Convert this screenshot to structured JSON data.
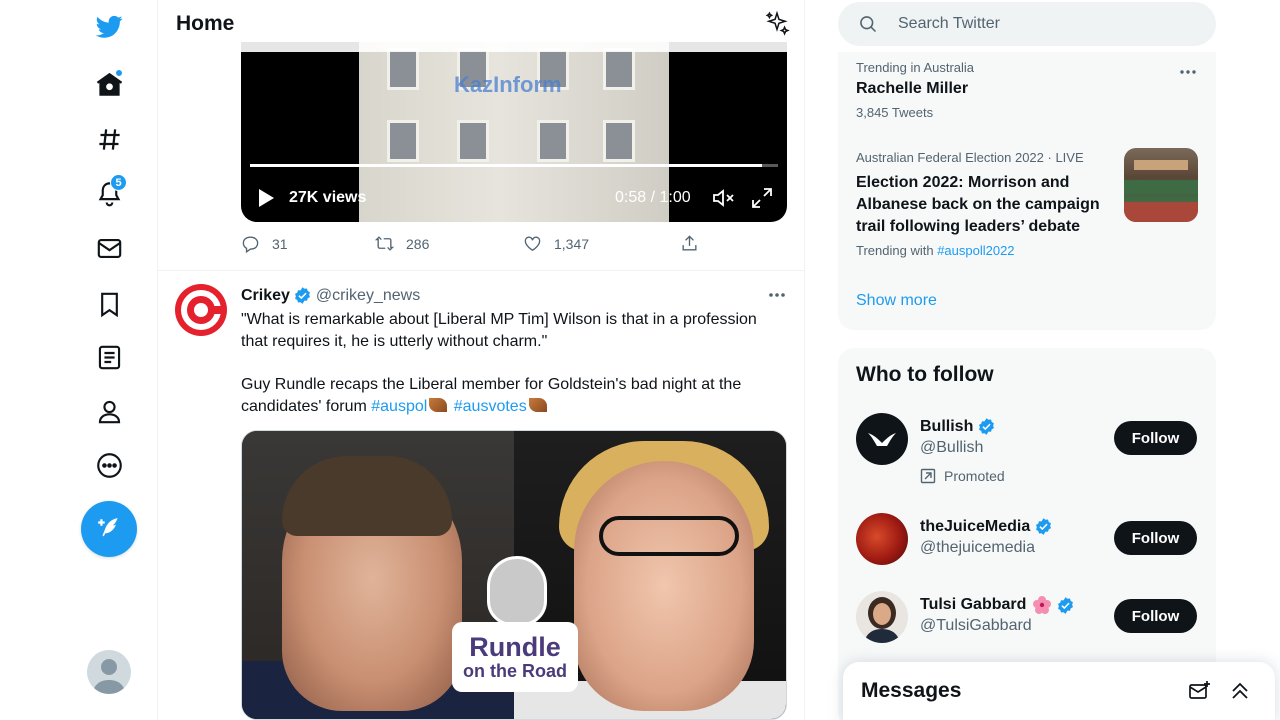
{
  "nav": {
    "items": [
      {
        "name": "twitter-logo-icon"
      },
      {
        "name": "home-icon"
      },
      {
        "name": "explore-hashtag-icon"
      },
      {
        "name": "notifications-bell-icon",
        "badge": "5"
      },
      {
        "name": "messages-envelope-icon"
      },
      {
        "name": "bookmarks-icon"
      },
      {
        "name": "lists-icon"
      },
      {
        "name": "profile-icon"
      },
      {
        "name": "more-icon"
      }
    ],
    "tweet_button_icon": "compose-feather-icon",
    "accent": "#1d9bf0"
  },
  "main": {
    "title": "Home",
    "video": {
      "logo_text": "KazInform",
      "views": "27K views",
      "time": "0:58 / 1:00",
      "progress": 0.97
    },
    "prev_tweet_actions": {
      "replies": "31",
      "retweets": "286",
      "likes": "1,347"
    },
    "tweet": {
      "author_name": "Crikey",
      "author_handle": "@crikey_news",
      "text_line1": "\"What is remarkable about [Liberal MP Tim] Wilson is that in a profession that requires it, he is utterly without charm.\"",
      "text_line2": "Guy Rundle recaps the Liberal member for Goldstein's bad night at the candidates' forum",
      "hashtag1": "#auspol",
      "hashtag2": "#ausvotes",
      "image_label_line1": "Rundle",
      "image_label_line2": "on the Road"
    }
  },
  "right": {
    "search_placeholder": "Search Twitter",
    "trends": [
      {
        "meta": "Trending in Australia",
        "name": "Rachelle Miller",
        "count": "3,845 Tweets"
      },
      {
        "meta": "Australian Federal Election 2022 · LIVE",
        "title": "Election 2022: Morrison and Albanese back on the campaign trail following leaders’ debate",
        "with_label": "Trending with",
        "with_tag": "#auspoll2022"
      }
    ],
    "show_more": "Show more",
    "who_to_follow": {
      "title": "Who to follow",
      "accounts": [
        {
          "name": "Bullish",
          "handle": "@Bullish",
          "promoted": "Promoted",
          "button": "Follow"
        },
        {
          "name": "theJuiceMedia",
          "handle": "@thejuicemedia",
          "button": "Follow"
        },
        {
          "name": "Tulsi Gabbard",
          "handle": "@TulsiGabbard",
          "button": "Follow"
        }
      ]
    },
    "messages_title": "Messages"
  }
}
